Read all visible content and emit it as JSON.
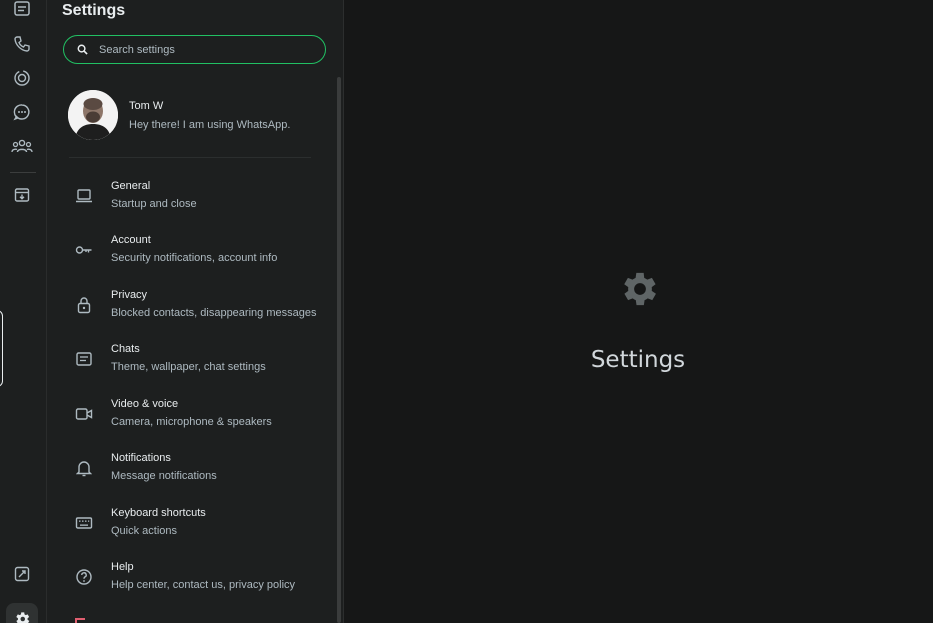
{
  "rail": {
    "items": [
      {
        "name": "chats-icon"
      },
      {
        "name": "calls-icon"
      },
      {
        "name": "status-icon"
      },
      {
        "name": "channels-icon"
      },
      {
        "name": "communities-icon"
      },
      {
        "name": "archived-icon"
      },
      {
        "name": "starred-icon"
      },
      {
        "name": "settings-icon"
      }
    ]
  },
  "panel": {
    "title": "Settings",
    "search": {
      "placeholder": "Search settings"
    },
    "profile": {
      "name": "Tom W",
      "status": "Hey there! I am using WhatsApp."
    },
    "items": [
      {
        "label": "General",
        "sub": "Startup and close",
        "icon": "laptop-icon"
      },
      {
        "label": "Account",
        "sub": "Security notifications, account info",
        "icon": "key-icon"
      },
      {
        "label": "Privacy",
        "sub": "Blocked contacts, disappearing messages",
        "icon": "lock-icon"
      },
      {
        "label": "Chats",
        "sub": "Theme, wallpaper, chat settings",
        "icon": "chat-icon"
      },
      {
        "label": "Video & voice",
        "sub": "Camera, microphone & speakers",
        "icon": "video-icon"
      },
      {
        "label": "Notifications",
        "sub": "Message notifications",
        "icon": "bell-icon"
      },
      {
        "label": "Keyboard shortcuts",
        "sub": "Quick actions",
        "icon": "keyboard-icon"
      },
      {
        "label": "Help",
        "sub": "Help center, contact us, privacy policy",
        "icon": "help-icon"
      }
    ]
  },
  "main": {
    "title": "Settings",
    "icon": "gear-icon"
  },
  "colors": {
    "accent": "#21c063",
    "background": "#161717",
    "panel": "#1d1f1f",
    "text": "#e9edef",
    "subtext": "#aebac1"
  }
}
